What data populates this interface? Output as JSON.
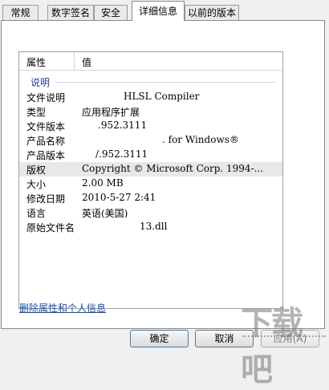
{
  "tabs": [
    {
      "label": "常规"
    },
    {
      "label": "数字签名"
    },
    {
      "label": "安全"
    },
    {
      "label": "详细信息",
      "active": true
    },
    {
      "label": "以前的版本"
    }
  ],
  "list": {
    "columns": {
      "property": "属性",
      "value": "值"
    },
    "group": "说明",
    "rows": [
      {
        "key": "文件说明",
        "value": "HLSL Compiler"
      },
      {
        "key": "类型",
        "value": "应用程序扩展"
      },
      {
        "key": "文件版本",
        "value": ".952.3111"
      },
      {
        "key": "产品名称",
        "value": ". for Windows®"
      },
      {
        "key": "产品版本",
        "value": "/.952.3111"
      },
      {
        "key": "版权",
        "value": "Copyright © Microsoft Corp. 1994-..."
      },
      {
        "key": "大小",
        "value": "2.00 MB"
      },
      {
        "key": "修改日期",
        "value": "2010-5-27 2:41"
      },
      {
        "key": "语言",
        "value": "英语(美国)"
      },
      {
        "key": "原始文件名",
        "value": "13.dll"
      }
    ]
  },
  "link": "删除属性和个人信息",
  "buttons": {
    "ok": "确定",
    "cancel": "取消",
    "apply": "应用(A)"
  },
  "watermark": "下载吧"
}
